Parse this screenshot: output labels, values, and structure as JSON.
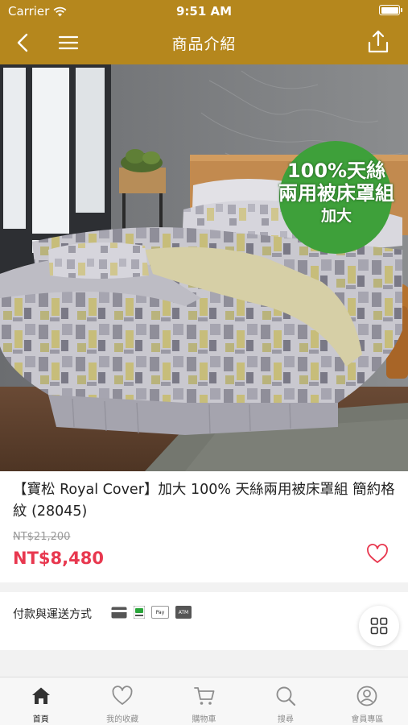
{
  "status_bar": {
    "carrier": "Carrier",
    "time": "9:51 AM"
  },
  "nav": {
    "title": "商品介紹"
  },
  "hero": {
    "badge_line1": "100%天絲",
    "badge_line2": "兩用被床罩組",
    "badge_line3": "加大",
    "badge_color": "#3ea03a"
  },
  "product": {
    "name": "【寶松 Royal Cover】加大 100% 天絲兩用被床罩組 簡約格紋 (28045)",
    "original_price": "NT$21,200",
    "price": "NT$8,480"
  },
  "payment": {
    "label": "付款與運送方式",
    "methods": [
      "card-icon",
      "line-pay-icon",
      "apple-pay-icon",
      "atm-icon"
    ],
    "apple_pay_text": "Pay",
    "atm_text": "ATM"
  },
  "tabs": [
    {
      "label": "首頁",
      "icon": "home-icon",
      "active": true
    },
    {
      "label": "我的收藏",
      "icon": "heart-icon",
      "active": false
    },
    {
      "label": "購物車",
      "icon": "cart-icon",
      "active": false
    },
    {
      "label": "搜尋",
      "icon": "search-icon",
      "active": false
    },
    {
      "label": "會員專區",
      "icon": "user-icon",
      "active": false
    }
  ],
  "colors": {
    "header": "#b5871d",
    "price": "#e8384f",
    "accent_tab": "#333333"
  }
}
